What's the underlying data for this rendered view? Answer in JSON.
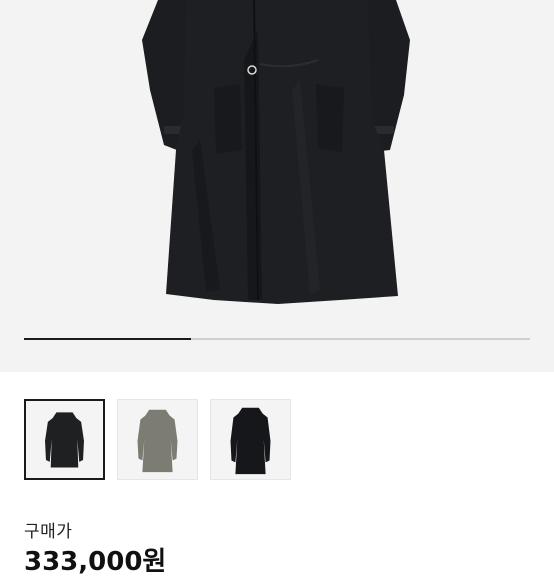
{
  "gallery": {
    "main_image": "coat-black-front",
    "progress_fraction": 0.33,
    "selected_index": 0,
    "thumbnails": [
      {
        "name": "coat-black-thumbnail",
        "color": "#1f2022"
      },
      {
        "name": "coat-olive-thumbnail",
        "color": "#7d7c72"
      },
      {
        "name": "coat-black-long-thumbnail",
        "color": "#15171a"
      }
    ]
  },
  "price": {
    "label": "구매가",
    "value": "333,000원"
  },
  "colors": {
    "coat": "#1d1e21",
    "background": "#f3f3f3",
    "accent": "#1a1a1a"
  }
}
